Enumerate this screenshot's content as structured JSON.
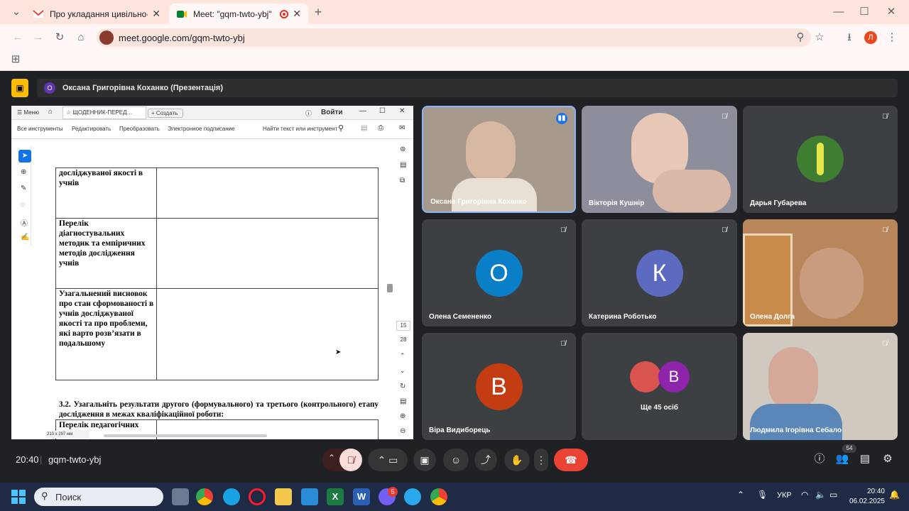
{
  "browser": {
    "tabs": [
      {
        "label": "Про укладання цивільно-прав",
        "favicon": "gmail-icon"
      },
      {
        "label": "Meet: \"gqm-twto-ybj\"",
        "favicon": "meet-icon"
      }
    ],
    "url": "meet.google.com/gqm-twto-ybj",
    "profile_initial": "Л",
    "new_tab": "+"
  },
  "presentation": {
    "badge": "О",
    "title": "Оксана Григорівна Коханко (Презентація)"
  },
  "pdf": {
    "tabs": {
      "menu": "Меню",
      "doc_tab": "ЩОДЕННИК-ПЕРЕД…",
      "create": "Создать",
      "login": "Войти"
    },
    "toolbar": [
      "Все инструменты",
      "Редактировать",
      "Преобразовать",
      "Электронное подписание"
    ],
    "search": "Найти текст или инструмент",
    "rows": [
      "досліджуваної якості в учнів",
      "Перелік діагностувальних методик та емпіричних методів дослідження учнів",
      "Узагальнений висновок про стан сформованості в учнів досліджуваної якості та про проблеми, які варто розв’язати в подальшому"
    ],
    "paragraph": "3.2. Узагальніть результати другого (формувального) та третього (контрольного) етапу дослідження в межах кваліфікаційної роботи:",
    "last_row": "Перелік педагогічних",
    "page_current": "15",
    "page_total": "28",
    "page_size": "210 х 297 мм"
  },
  "participants": [
    {
      "name": "Оксана Григорівна Коханко",
      "type": "video",
      "speaking": true
    },
    {
      "name": "Вікторія Кушнір",
      "type": "video",
      "muted": true
    },
    {
      "name": "Дарья Губарева",
      "type": "photo",
      "muted": true
    },
    {
      "name": "Олена Семененко",
      "type": "avatar",
      "initial": "О",
      "color": "#0b7ec8",
      "muted": true
    },
    {
      "name": "Катерина Роботько",
      "type": "avatar",
      "initial": "К",
      "color": "#5c6bc0",
      "muted": true
    },
    {
      "name": "Олена Долга",
      "type": "video",
      "muted": true
    },
    {
      "name": "Віра Видиборець",
      "type": "avatar",
      "initial": "В",
      "color": "#c43d12",
      "muted": true
    },
    {
      "name": "Ще 45 осіб",
      "type": "more",
      "initial": "В"
    },
    {
      "name": "Людмила Ігорівна Себало",
      "type": "video",
      "muted": true
    }
  ],
  "meeting": {
    "time": "20:40",
    "code": "gqm-twto-ybj",
    "people_count": "54"
  },
  "taskbar": {
    "search": "Поиск",
    "lang": "УКР",
    "clock_time": "20:40",
    "clock_date": "06.02.2025",
    "badge_viber": "5"
  }
}
